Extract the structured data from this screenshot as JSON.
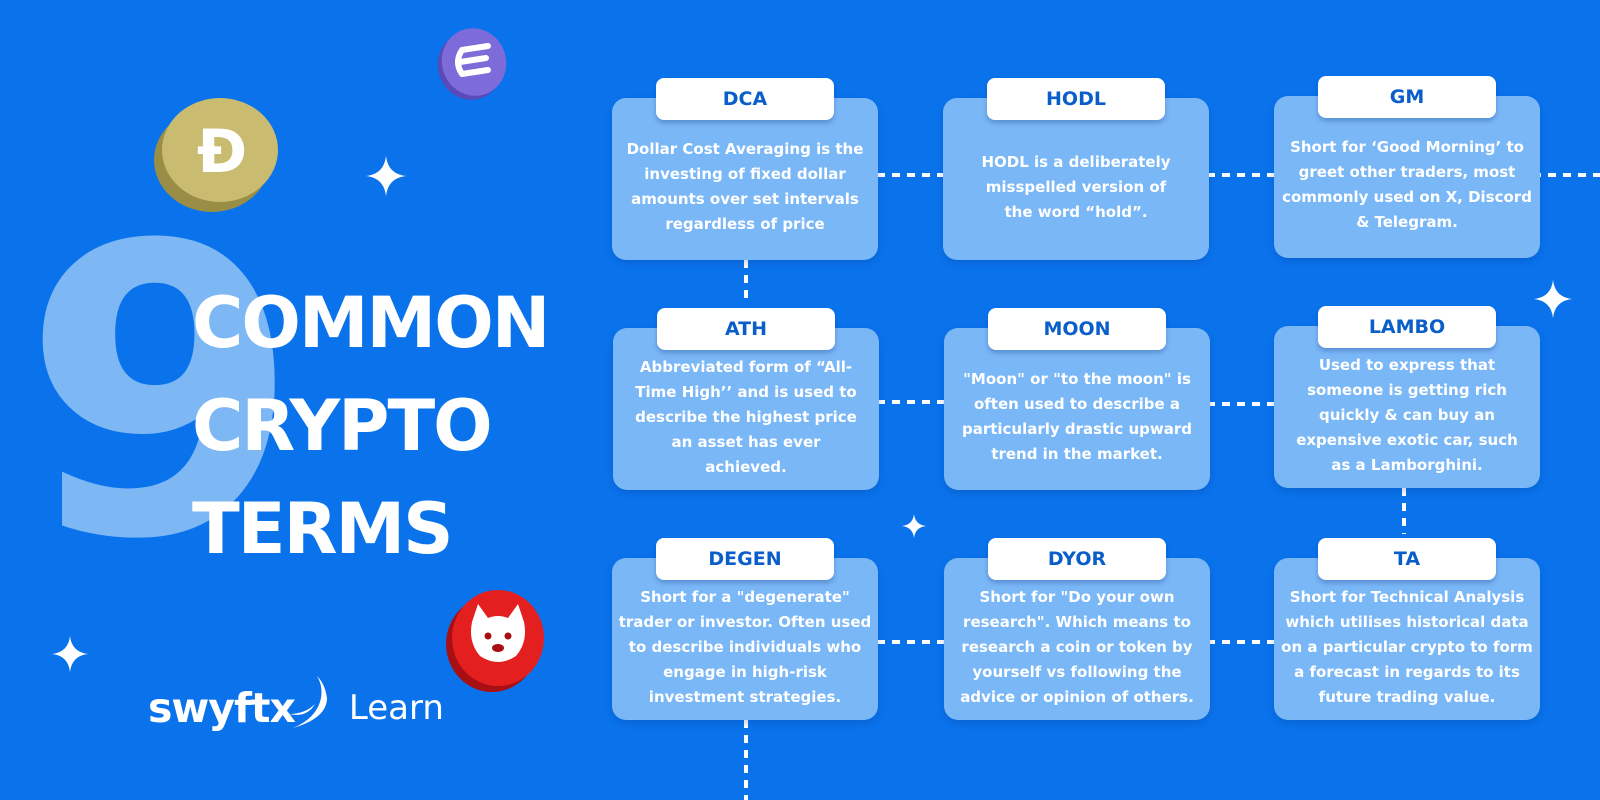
{
  "hero": {
    "number": "9",
    "headline_lines": [
      "COMMON",
      "CRYPTO",
      "TERMS"
    ]
  },
  "brand": {
    "name": "swyftx",
    "section": "Learn"
  },
  "terms": [
    {
      "term": "DCA",
      "definition": "Dollar Cost Averaging is the investing of fixed dollar amounts over set intervals regardless of price"
    },
    {
      "term": "HODL",
      "definition": "HODL is a deliberately misspelled version of the word “hold”."
    },
    {
      "term": "GM",
      "definition": "Short for ‘Good Morning’ to greet other traders, most commonly used on X, Discord & Telegram."
    },
    {
      "term": "ATH",
      "definition": "Abbreviated form of “All-Time High’’ and is used to describe the highest price an asset has ever achieved."
    },
    {
      "term": "MOON",
      "definition": "\"Moon\" or \"to the moon\" is often used to describe a particularly drastic upward trend in the market."
    },
    {
      "term": "LAMBO",
      "definition": "Used to express that someone is getting rich quickly & can buy an expensive exotic car, such as a Lamborghini."
    },
    {
      "term": "DEGEN",
      "definition": "Short for a \"degenerate\" trader or investor. Often used to describe individuals who engage in high-risk investment strategies."
    },
    {
      "term": "DYOR",
      "definition": "Short for \"Do your own research\". Which means to research a coin or token by yourself vs following the advice or opinion of others."
    },
    {
      "term": "TA",
      "definition": "Short for Technical Analysis which utilises historical data on a particular crypto to form a forecast in regards to its future trading value."
    }
  ],
  "coins": [
    {
      "name": "dogecoin-coin-icon",
      "symbol": "Ð",
      "color": "#c9bc70"
    },
    {
      "name": "ethena-coin-icon",
      "color": "#7d6bd9"
    },
    {
      "name": "shiba-coin-icon",
      "color": "#e41f20"
    }
  ],
  "colors": {
    "background": "#0a73ec",
    "card": "#7ab7f7",
    "tab_text": "#0a5ec9",
    "big_number": "#7db8f5"
  }
}
